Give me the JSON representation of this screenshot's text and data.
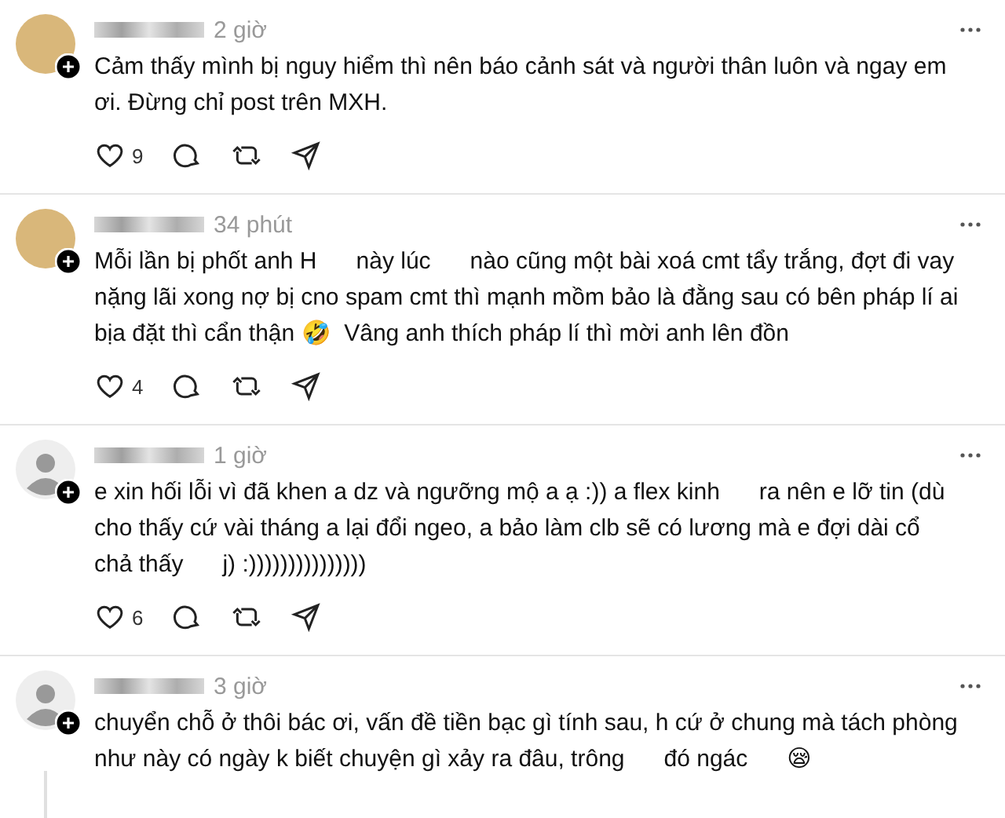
{
  "comments": [
    {
      "avatar": {
        "kind": "photo"
      },
      "time": "2 giờ",
      "text": "Cảm thấy mình bị nguy hiểm thì nên báo cảnh sát và người thân luôn và ngay em ơi. Đừng chỉ post trên MXH.",
      "likes": "9",
      "thread": false
    },
    {
      "avatar": {
        "kind": "photo"
      },
      "time": "34 phút",
      "text": "Mỗi lần bị phốt anh H      này lúc      nào cũng một bài xoá cmt tẩy trắng, đợt đi vay nặng lãi xong nợ bị cno spam cmt thì mạnh mồm bảo là đằng sau có bên pháp lí ai bịa đặt thì cẩn thận 🤣  Vâng anh thích pháp lí thì mời anh lên đồn",
      "likes": "4",
      "thread": false
    },
    {
      "avatar": {
        "kind": "default"
      },
      "time": "1 giờ",
      "text": "e xin hối lỗi vì đã khen a dz và ngưỡng mộ a ạ :)) a flex kinh      ra nên e lỡ tin (dù cho thấy cứ vài tháng a lại đổi ngeo, a bảo làm clb sẽ có lương mà e đợi dài cổ chả thấy      j) :)))))))))))))))",
      "likes": "6",
      "thread": false
    },
    {
      "avatar": {
        "kind": "default"
      },
      "time": "3 giờ",
      "text": "chuyển chỗ ở thôi bác ơi, vấn đề tiền bạc gì tính sau, h cứ ở chung mà tách phòng như này có ngày k biết chuyện gì xảy ra đâu, trông      đó ngác      😪",
      "thread": true
    }
  ]
}
